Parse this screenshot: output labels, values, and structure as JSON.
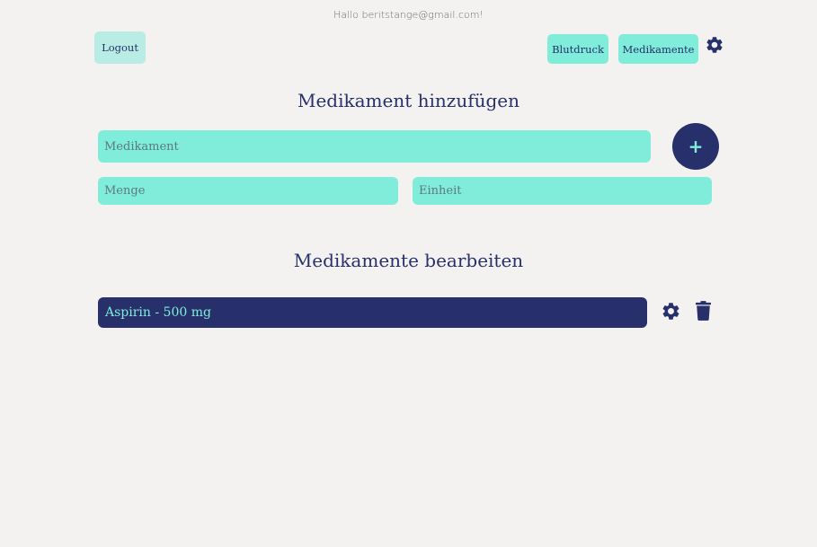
{
  "header": {
    "greeting": "Hallo beritstange@gmail.com!",
    "logout_label": "Logout",
    "nav": [
      {
        "label": "Blutdruck"
      },
      {
        "label": "Medikamente"
      }
    ],
    "settings_icon": "gear-icon"
  },
  "add_section": {
    "title": "Medikament hinzufügen",
    "medikament_placeholder": "Medikament",
    "menge_placeholder": "Menge",
    "einheit_placeholder": "Einheit",
    "add_label": "+"
  },
  "edit_section": {
    "title": "Medikamente bearbeiten",
    "items": [
      {
        "label": "Aspirin - 500 mg",
        "edit_icon": "gear-icon",
        "delete_icon": "trash-icon"
      }
    ]
  },
  "colors": {
    "background": "#f4f2f1",
    "accent": "#80ecda",
    "primary": "#27306a"
  }
}
